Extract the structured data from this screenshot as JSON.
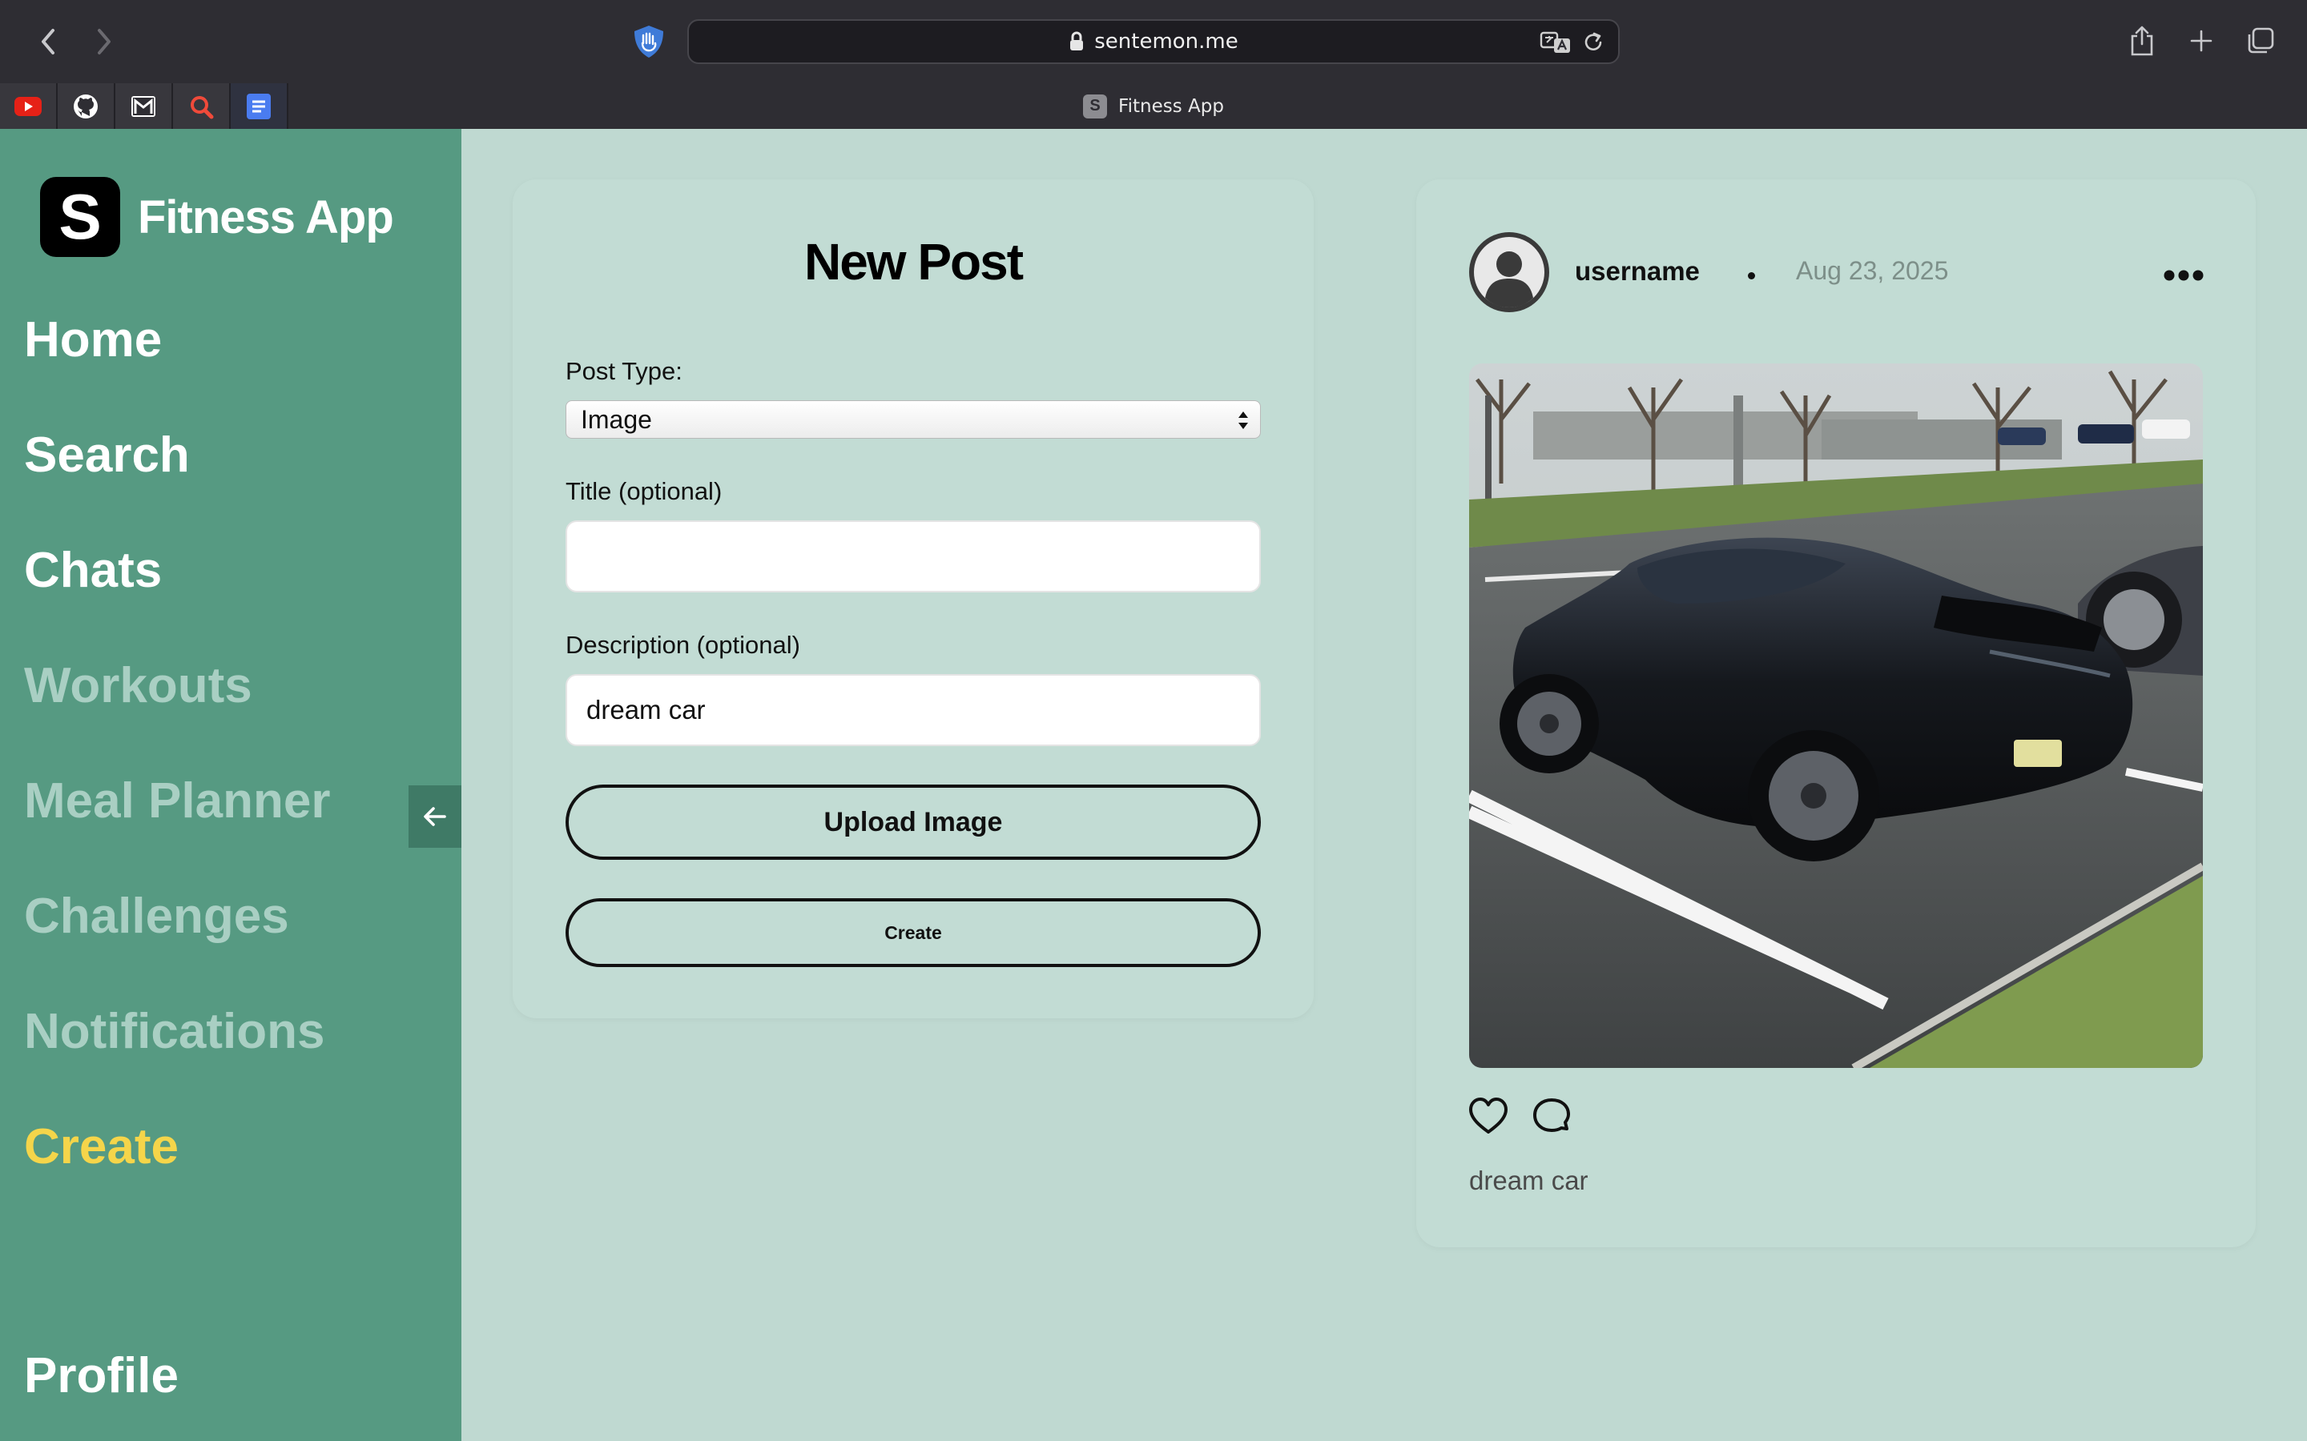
{
  "browser": {
    "url": "sentemon.me",
    "tab_title": "Fitness App",
    "tab_favicon_letter": "S",
    "bookmarks": [
      {
        "icon": "youtube-icon"
      },
      {
        "icon": "github-icon"
      },
      {
        "icon": "gmail-icon"
      },
      {
        "icon": "search-magnifier-icon"
      },
      {
        "icon": "docs-icon"
      }
    ]
  },
  "sidebar": {
    "brand_letter": "S",
    "brand_name": "Fitness App",
    "items": {
      "home": "Home",
      "search": "Search",
      "chats": "Chats",
      "workouts": "Workouts",
      "meal": "Meal Planner",
      "challenges": "Challenges",
      "notifications": "Notifications",
      "create": "Create",
      "profile": "Profile"
    },
    "active_item": "Create",
    "colors": {
      "background": "#569a82",
      "active": "#f5d54a",
      "dim": "#a9cfc3"
    }
  },
  "new_post": {
    "title": "New Post",
    "post_type_label": "Post Type:",
    "post_type_value": "Image",
    "title_label": "Title (optional)",
    "title_value": "",
    "description_label": "Description (optional)",
    "description_value": "dream car",
    "upload_button": "Upload Image",
    "create_button": "Create"
  },
  "post_preview": {
    "username": "username",
    "date": "Aug 23, 2025",
    "caption": "dream car",
    "image_subject": "black sports car in parking lot"
  },
  "colors": {
    "page_background": "#bfd9d1",
    "card_background": "#c2dcd4"
  }
}
